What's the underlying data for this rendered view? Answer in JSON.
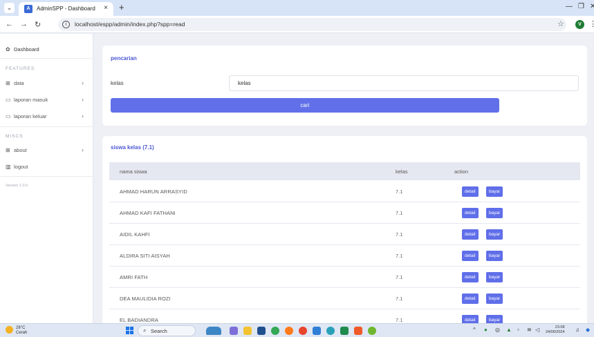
{
  "browser": {
    "tab_title": "AdminSPP - Dashboard",
    "tab_close": "×",
    "new_tab": "+",
    "url": "localhost/espp/admin/index.php?spp=read",
    "profile_initial": "V"
  },
  "sidebar": {
    "dashboard": "Dashboard",
    "features_heading": "FEATURES",
    "items": [
      {
        "label": "data",
        "icon": "table-icon"
      },
      {
        "label": "laporan masuk",
        "icon": "calendar-icon"
      },
      {
        "label": "laporan keluar",
        "icon": "calendar-icon"
      }
    ],
    "miscs_heading": "MISCS",
    "about": "about",
    "logout": "logout",
    "version": "Version 1.0.0"
  },
  "search": {
    "title": "pencarian",
    "label": "kelas",
    "value": "kelas",
    "button": "cari"
  },
  "table": {
    "title": "siswa kelas (7.1)",
    "headers": [
      "nama siswa",
      "kelas",
      "action"
    ],
    "detail_label": "detail",
    "bayar_label": "bayar",
    "rows": [
      {
        "nama": "AHMAD HARUN ARRASYID",
        "kelas": "7.1"
      },
      {
        "nama": "AHMAD KAFI FATHANI",
        "kelas": "7.1"
      },
      {
        "nama": "AIDIL KAHFI",
        "kelas": "7.1"
      },
      {
        "nama": "ALDIRA SITI AISYAH",
        "kelas": "7.1"
      },
      {
        "nama": "AMRI FATH",
        "kelas": "7.1"
      },
      {
        "nama": "DEA MAULIDIA ROZI",
        "kelas": "7.1"
      },
      {
        "nama": "EL BADIANDRA",
        "kelas": "7.1"
      }
    ]
  },
  "taskbar": {
    "temperature": "28°C",
    "weather": "Cerah",
    "search": "Search",
    "time": "23.08",
    "date": "24/06/2024"
  }
}
